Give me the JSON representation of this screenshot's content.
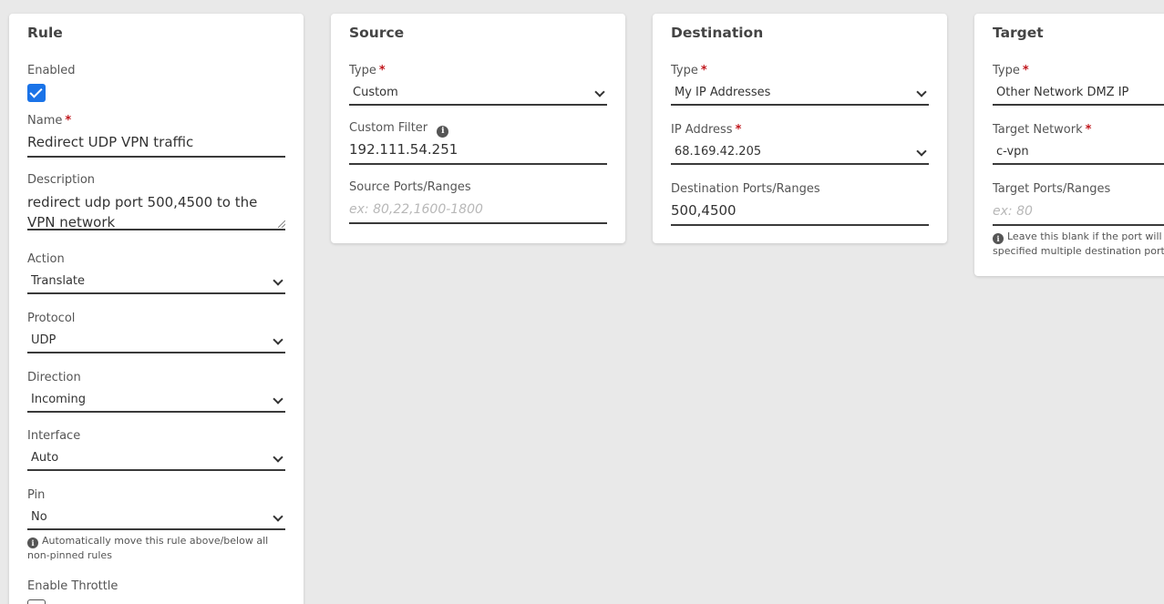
{
  "rule": {
    "title": "Rule",
    "enabled_label": "Enabled",
    "name_label": "Name",
    "name_value": "Redirect UDP VPN traffic",
    "description_label": "Description",
    "description_value": "redirect udp port 500,4500 to the VPN network",
    "action_label": "Action",
    "action_value": "Translate",
    "protocol_label": "Protocol",
    "protocol_value": "UDP",
    "direction_label": "Direction",
    "direction_value": "Incoming",
    "interface_label": "Interface",
    "interface_value": "Auto",
    "pin_label": "Pin",
    "pin_value": "No",
    "pin_hint": "Automatically move this rule above/below all non-pinned rules",
    "throttle_label": "Enable Throttle"
  },
  "source": {
    "title": "Source",
    "type_label": "Type",
    "type_value": "Custom",
    "filter_label": "Custom Filter",
    "filter_value": "192.111.54.251",
    "ports_label": "Source Ports/Ranges",
    "ports_placeholder": "ex: 80,22,1600-1800"
  },
  "destination": {
    "title": "Destination",
    "type_label": "Type",
    "type_value": "My IP Addresses",
    "ip_label": "IP Address",
    "ip_value": "68.169.42.205",
    "ports_label": "Destination Ports/Ranges",
    "ports_value": "500,4500"
  },
  "target": {
    "title": "Target",
    "type_label": "Type",
    "type_value": "Other Network DMZ IP",
    "network_label": "Target Network",
    "network_value": "c-vpn",
    "ports_label": "Target Ports/Ranges",
    "ports_placeholder": "ex: 80",
    "ports_hint_1": "Leave this blank if the port will be t",
    "ports_hint_2": "specified multiple destination ports"
  },
  "icons": {
    "info": "i",
    "required": "*"
  },
  "colors": {
    "checkbox": "#1a73e8",
    "required": "#c0151b",
    "background": "#e9e9e9"
  }
}
